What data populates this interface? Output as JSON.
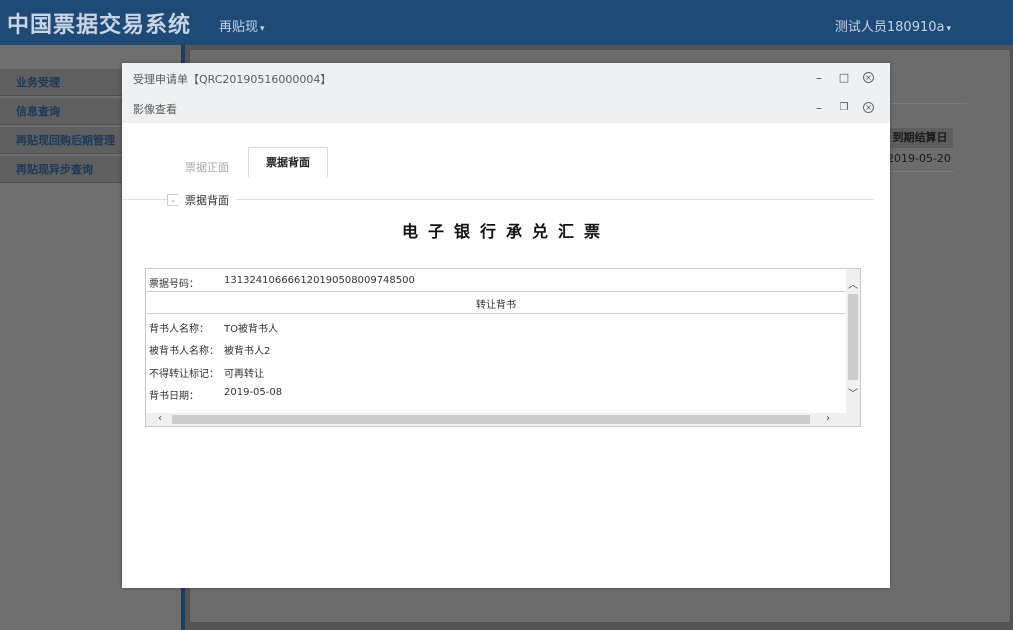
{
  "app": {
    "title": "中国票据交易系统",
    "nav_label": "再贴现",
    "user_label": "测试人员180910a"
  },
  "sidebar": {
    "items": [
      {
        "label": "业务受理"
      },
      {
        "label": "信息查询"
      },
      {
        "label": "再贴现回购后期管理"
      },
      {
        "label": "再贴现异步查询"
      }
    ]
  },
  "background_table": {
    "header": "到期结算日",
    "cell": "2019-05-20"
  },
  "modal": {
    "title": "受理申请单【QRC20190516000004】",
    "subtitle": "影像查看",
    "tabs": [
      {
        "label": "票据正面"
      },
      {
        "label": "票据背面"
      }
    ],
    "section_label": "票据背面",
    "document_title": "电子银行承兑汇票",
    "bill_number_label": "票据号码：",
    "bill_number": "131324106666120190508009748500",
    "transfer_header": "转让背书",
    "fields": [
      {
        "label": "背书人名称：",
        "value": "TO被背书人"
      },
      {
        "label": "被背书人名称：",
        "value": "被背书人2"
      },
      {
        "label": "不得转让标记：",
        "value": "可再转让"
      },
      {
        "label": "背书日期：",
        "value": "2019-05-08"
      }
    ]
  }
}
